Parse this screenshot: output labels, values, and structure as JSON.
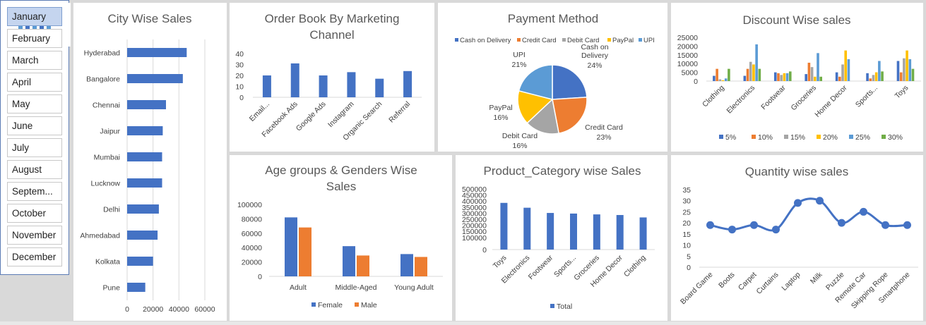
{
  "slicer": {
    "items": [
      "January",
      "February",
      "March",
      "April",
      "May",
      "June",
      "July",
      "August",
      "Septem...",
      "October",
      "November",
      "December"
    ],
    "selected_index": 0
  },
  "logo": {
    "icon": "bar-chart-logo-icon"
  },
  "colors": {
    "primary": "#4472c4",
    "orange": "#ed7d31",
    "gray": "#a5a5a5",
    "yellow": "#ffc000",
    "lightblue": "#5b9bd5",
    "green": "#70ad47"
  },
  "chart_data": [
    {
      "id": "city",
      "type": "bar",
      "orientation": "horizontal",
      "title": "City Wise Sales",
      "categories": [
        "Hyderabad",
        "Bangalore",
        "Chennai",
        "Jaipur",
        "Mumbai",
        "Lucknow",
        "Delhi",
        "Ahmedabad",
        "Kolkata",
        "Pune"
      ],
      "values": [
        46000,
        43000,
        30000,
        27500,
        27000,
        27000,
        24500,
        23500,
        20000,
        14000
      ],
      "xlim": [
        0,
        60000
      ],
      "xticks": [
        "0",
        "20000",
        "40000",
        "60000"
      ],
      "grid": true
    },
    {
      "id": "channel",
      "type": "bar",
      "title_lines": [
        "Order Book By Marketing",
        "Channel"
      ],
      "categories": [
        "Email...",
        "Facebook Ads",
        "Google Ads",
        "Instagram",
        "Organic Search",
        "Referral"
      ],
      "values": [
        20,
        31,
        20,
        23,
        17,
        24
      ],
      "ylim": [
        0,
        40
      ],
      "yticks": [
        "0",
        "10",
        "20",
        "30",
        "40"
      ]
    },
    {
      "id": "payment",
      "type": "pie",
      "title": "Payment Method",
      "legend": [
        "Cash on Delivery",
        "Credit Card",
        "Debit Card",
        "PayPal",
        "UPI"
      ],
      "values": [
        24,
        23,
        16,
        16,
        21
      ],
      "labels": [
        {
          "name": [
            "Cash on",
            "Delivery"
          ],
          "pct": "24%"
        },
        {
          "name": [
            "Credit Card"
          ],
          "pct": "23%"
        },
        {
          "name": [
            "Debit Card"
          ],
          "pct": "16%"
        },
        {
          "name": [
            "PayPal"
          ],
          "pct": "16%"
        },
        {
          "name": [
            "UPI"
          ],
          "pct": "21%"
        }
      ]
    },
    {
      "id": "discount",
      "type": "bar",
      "title": "Discount Wise sales",
      "categories": [
        "Clothing",
        "Electronics",
        "Footwear",
        "Groceries",
        "Home Decor",
        "Sports...",
        "Toys"
      ],
      "series": [
        {
          "name": "5%",
          "values": [
            3000,
            3000,
            5000,
            4000,
            5000,
            4500,
            11500
          ]
        },
        {
          "name": "10%",
          "values": [
            7000,
            7000,
            4500,
            10500,
            2500,
            1500,
            5000
          ]
        },
        {
          "name": "15%",
          "values": [
            1000,
            11000,
            3500,
            8000,
            9500,
            3500,
            13000
          ]
        },
        {
          "name": "20%",
          "values": [
            500,
            9500,
            4500,
            2500,
            17500,
            5000,
            17500
          ]
        },
        {
          "name": "25%",
          "values": [
            1500,
            21000,
            4500,
            16000,
            12500,
            11500,
            12500
          ]
        },
        {
          "name": "30%",
          "values": [
            7000,
            7000,
            5500,
            2500,
            0,
            5500,
            7000
          ]
        }
      ],
      "ylim": [
        0,
        25000
      ],
      "yticks": [
        "0",
        "5000",
        "10000",
        "15000",
        "20000",
        "25000"
      ],
      "legend_position": "bottom"
    },
    {
      "id": "age",
      "type": "bar",
      "title_lines": [
        "Age groups & Genders Wise",
        "Sales"
      ],
      "categories": [
        "Adult",
        "Middle-Aged",
        "Young Adult"
      ],
      "series": [
        {
          "name": "Female",
          "values": [
            82000,
            42000,
            31000
          ]
        },
        {
          "name": "Male",
          "values": [
            68000,
            29000,
            27000
          ]
        }
      ],
      "ylim": [
        0,
        100000
      ],
      "yticks": [
        "0",
        "20000",
        "40000",
        "60000",
        "80000",
        "100000"
      ],
      "legend_position": "bottom"
    },
    {
      "id": "product",
      "type": "bar",
      "title": "Product_Category wise Sales",
      "categories": [
        "Toys",
        "Electronics",
        "Footwear",
        "Sports...",
        "Groceries",
        "Home Decor",
        "Clothing"
      ],
      "series": [
        {
          "name": "Total",
          "values": [
            385000,
            345000,
            302000,
            297000,
            290000,
            285000,
            265000
          ]
        }
      ],
      "ylim": [
        0,
        500000
      ],
      "yticks": [
        "0",
        "100000",
        "150000",
        "200000",
        "250000",
        "300000",
        "350000",
        "400000",
        "450000",
        "500000"
      ],
      "legend_position": "bottom"
    },
    {
      "id": "quantity",
      "type": "line",
      "title": "Quantity wise sales",
      "categories": [
        "Board Game",
        "Boots",
        "Carpet",
        "Curtains",
        "Laptop",
        "Milk",
        "Puzzle",
        "Remote Car",
        "Skipping Rope",
        "Smartphone"
      ],
      "values": [
        19,
        17,
        19,
        17,
        29,
        30,
        20,
        25,
        19,
        19
      ],
      "ylim": [
        0,
        35
      ],
      "yticks": [
        "0",
        "5",
        "10",
        "15",
        "20",
        "25",
        "30",
        "35"
      ]
    }
  ]
}
